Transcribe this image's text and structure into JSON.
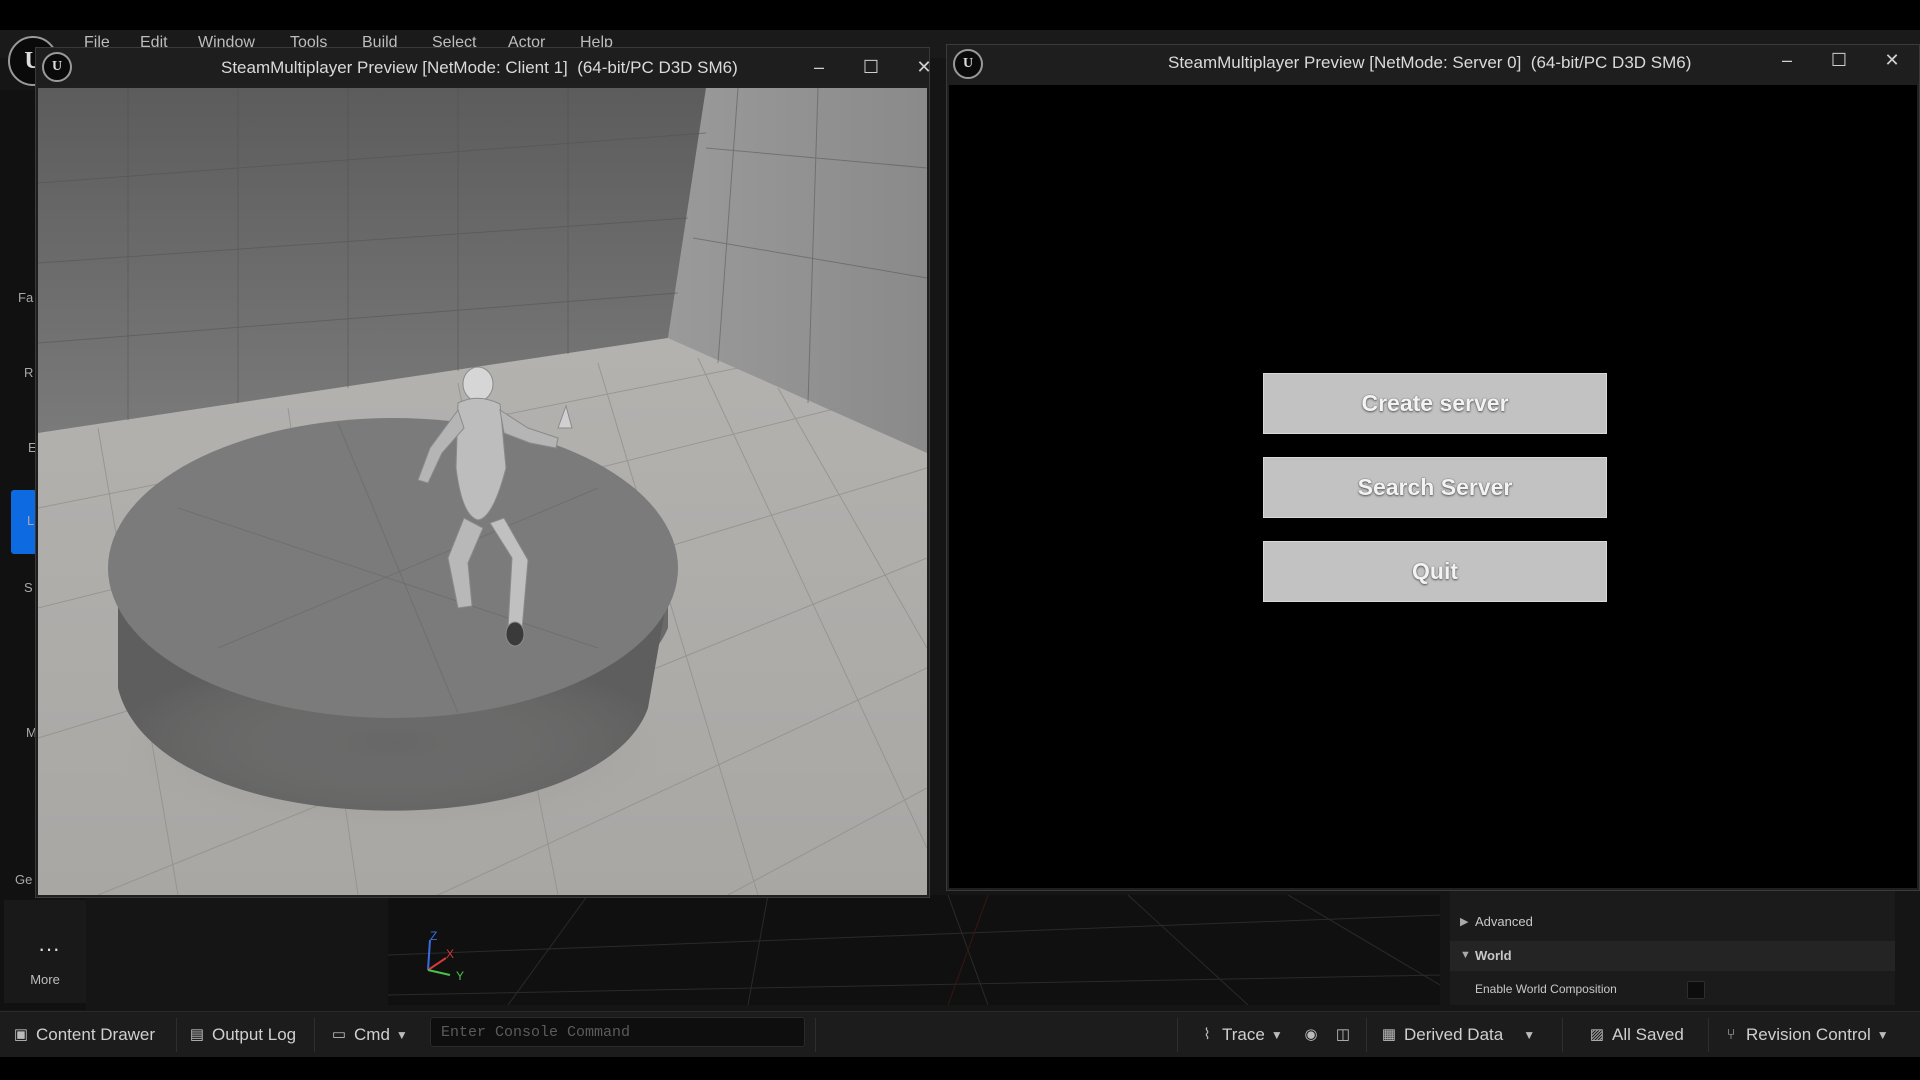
{
  "menubar": {
    "items": [
      "File",
      "Edit",
      "Window",
      "Tools",
      "Build",
      "Select",
      "Actor",
      "Help"
    ]
  },
  "left_toolbar": {
    "letters": [
      "Fa",
      "R",
      "E",
      "L",
      "S",
      "M",
      "Ge"
    ],
    "more_label": "More"
  },
  "client_window": {
    "title": "SteamMultiplayer Preview [NetMode: Client 1]  (64-bit/PC D3D SM6)",
    "minimize": "–",
    "maximize": "☐",
    "close": "✕"
  },
  "server_window": {
    "title": "SteamMultiplayer Preview [NetMode: Server 0]  (64-bit/PC D3D SM6)",
    "minimize": "–",
    "maximize": "☐",
    "close": "✕",
    "buttons": [
      "Create server",
      "Search Server",
      "Quit"
    ]
  },
  "details": {
    "advanced": "Advanced",
    "world": "World",
    "enable_world_composition": "Enable World Composition"
  },
  "viewport_axes": {
    "z": "Z",
    "x": "X",
    "y": "Y"
  },
  "statusbar": {
    "content_drawer": "Content Drawer",
    "output_log": "Output Log",
    "cmd": "Cmd",
    "console_placeholder": "Enter Console Command",
    "trace": "Trace",
    "derived_data": "Derived Data",
    "all_saved": "All Saved",
    "revision_control": "Revision Control"
  }
}
